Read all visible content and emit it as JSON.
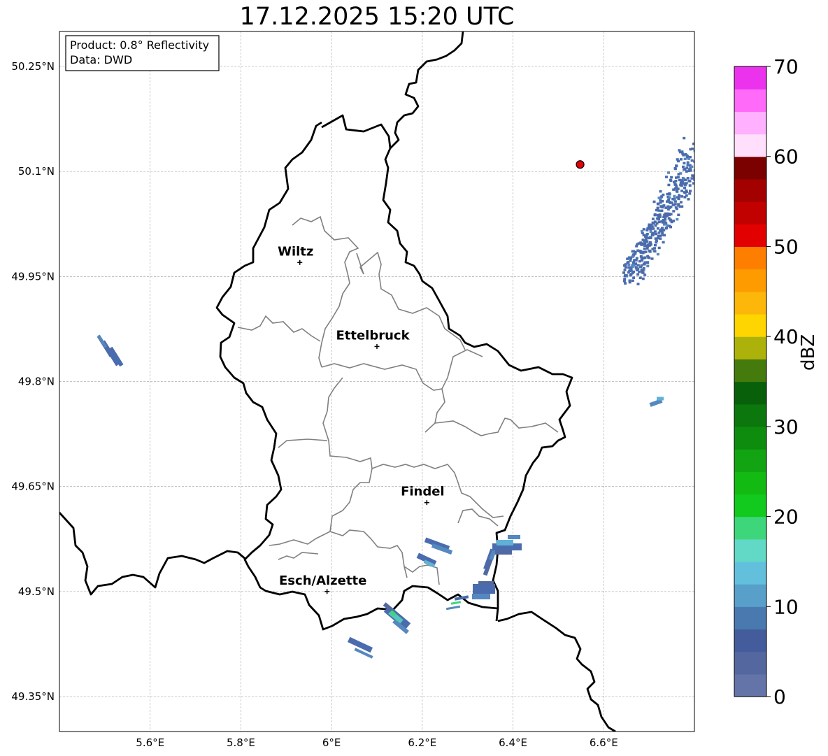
{
  "title": "17.12.2025 15:20 UTC",
  "info_box": {
    "product": "Product: 0.8° Reflectivity",
    "data": "Data: DWD"
  },
  "axes": {
    "lon_range": [
      5.4,
      6.8
    ],
    "lat_range": [
      49.3,
      50.3
    ],
    "x_ticks": [
      {
        "value": 5.6,
        "label": "5.6°E"
      },
      {
        "value": 5.8,
        "label": "5.8°E"
      },
      {
        "value": 6.0,
        "label": "6°E"
      },
      {
        "value": 6.2,
        "label": "6.2°E"
      },
      {
        "value": 6.4,
        "label": "6.4°E"
      },
      {
        "value": 6.6,
        "label": "6.6°E"
      }
    ],
    "y_ticks": [
      {
        "value": 50.25,
        "label": "50.25°N"
      },
      {
        "value": 50.1,
        "label": "50.1°N"
      },
      {
        "value": 49.95,
        "label": "49.95°N"
      },
      {
        "value": 49.8,
        "label": "49.8°N"
      },
      {
        "value": 49.65,
        "label": "49.65°N"
      },
      {
        "value": 49.5,
        "label": "49.5°N"
      },
      {
        "value": 49.35,
        "label": "49.35°N"
      }
    ],
    "grid": true
  },
  "cities": [
    {
      "name": "Wiltz",
      "lon": 5.93,
      "lat": 49.97
    },
    {
      "name": "Ettelbruck",
      "lon": 6.1,
      "lat": 49.85
    },
    {
      "name": "Findel",
      "lon": 6.21,
      "lat": 49.627
    },
    {
      "name": "Esch/Alzette",
      "lon": 5.99,
      "lat": 49.5
    }
  ],
  "radar_site": {
    "lon": 6.548,
    "lat": 50.11,
    "color": "#e8000b"
  },
  "colorbar": {
    "label": "dBZ",
    "min": 0,
    "max": 70,
    "tick_labels": [
      "0",
      "10",
      "20",
      "30",
      "40",
      "50",
      "60",
      "70"
    ],
    "colors": [
      "#6473a8",
      "#54679f",
      "#445c9c",
      "#4a79b0",
      "#589fca",
      "#62c0dd",
      "#62d8c6",
      "#3ed67a",
      "#12c91e",
      "#12ba12",
      "#12a412",
      "#0e8c0e",
      "#0c770c",
      "#08600a",
      "#457a0c",
      "#adb20b",
      "#fed500",
      "#fdb60a",
      "#fe9b00",
      "#fe7f00",
      "#e30000",
      "#c10000",
      "#a30000",
      "#7b0000",
      "#ffdffc",
      "#ffb0fe",
      "#ff6af9",
      "#eb33ee"
    ]
  },
  "echo_colors": [
    "#5169a0",
    "#4a6cae",
    "#5588bf",
    "#61b0d6",
    "#55c8b5",
    "#3ed67a",
    "#12c91e"
  ]
}
